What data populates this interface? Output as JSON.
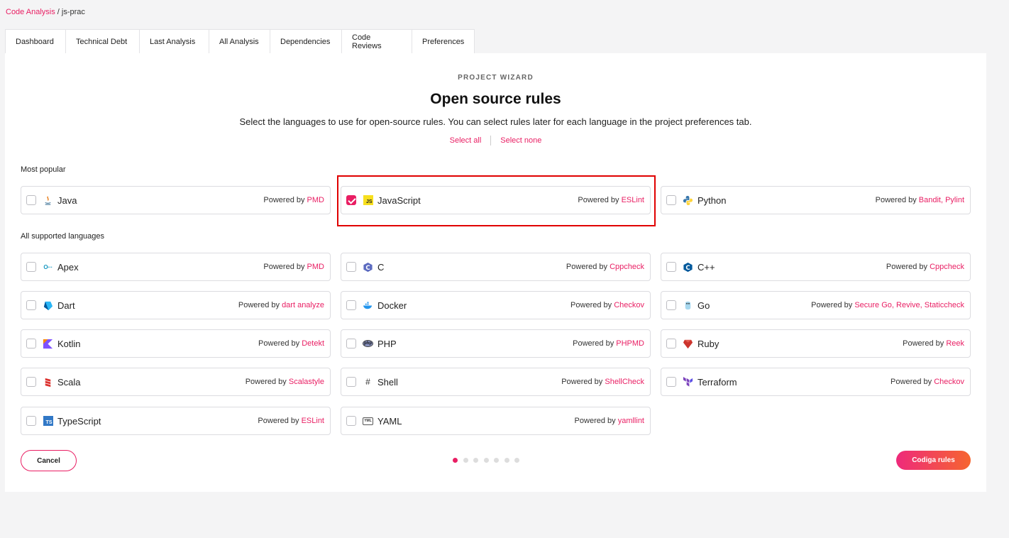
{
  "breadcrumb": {
    "parent": "Code Analysis",
    "separator": " / ",
    "current": "js-prac"
  },
  "tabs": [
    "Dashboard",
    "Technical Debt",
    "Last Analysis",
    "All Analysis",
    "Dependencies",
    "Code Reviews",
    "Preferences"
  ],
  "wizard": {
    "eyebrow": "PROJECT WIZARD",
    "title": "Open source rules",
    "subtitle": "Select the languages to use for open-source rules. You can select rules later for each language in the project preferences tab.",
    "select_all": "Select all",
    "select_none": "Select none",
    "most_popular_label": "Most popular",
    "all_supported_label": "All supported languages",
    "powered_by": "Powered by",
    "popular": [
      {
        "name": "Java",
        "tools": "PMD",
        "checked": false,
        "icon": "java-icon"
      },
      {
        "name": "JavaScript",
        "tools": "ESLint",
        "checked": true,
        "icon": "javascript-icon"
      },
      {
        "name": "Python",
        "tools": "Bandit, Pylint",
        "checked": false,
        "icon": "python-icon"
      }
    ],
    "languages": [
      {
        "name": "Apex",
        "tools": "PMD",
        "checked": false,
        "icon": "apex-icon"
      },
      {
        "name": "C",
        "tools": "Cppcheck",
        "checked": false,
        "icon": "c-icon"
      },
      {
        "name": "C++",
        "tools": "Cppcheck",
        "checked": false,
        "icon": "cpp-icon"
      },
      {
        "name": "Dart",
        "tools": "dart analyze",
        "checked": false,
        "icon": "dart-icon"
      },
      {
        "name": "Docker",
        "tools": "Checkov",
        "checked": false,
        "icon": "docker-icon"
      },
      {
        "name": "Go",
        "tools": "Secure Go, Revive, Staticcheck",
        "checked": false,
        "icon": "go-icon"
      },
      {
        "name": "Kotlin",
        "tools": "Detekt",
        "checked": false,
        "icon": "kotlin-icon"
      },
      {
        "name": "PHP",
        "tools": "PHPMD",
        "checked": false,
        "icon": "php-icon"
      },
      {
        "name": "Ruby",
        "tools": "Reek",
        "checked": false,
        "icon": "ruby-icon"
      },
      {
        "name": "Scala",
        "tools": "Scalastyle",
        "checked": false,
        "icon": "scala-icon"
      },
      {
        "name": "Shell",
        "tools": "ShellCheck",
        "checked": false,
        "icon": "shell-icon"
      },
      {
        "name": "Terraform",
        "tools": "Checkov",
        "checked": false,
        "icon": "terraform-icon"
      },
      {
        "name": "TypeScript",
        "tools": "ESLint",
        "checked": false,
        "icon": "typescript-icon"
      },
      {
        "name": "YAML",
        "tools": "yamllint",
        "checked": false,
        "icon": "yaml-icon"
      }
    ],
    "cancel_label": "Cancel",
    "next_label": "Codiga rules",
    "steps_total": 7,
    "step_current": 1
  },
  "colors": {
    "accent": "#e91e63",
    "accent_end": "#f6652f",
    "highlight": "#e00000"
  }
}
